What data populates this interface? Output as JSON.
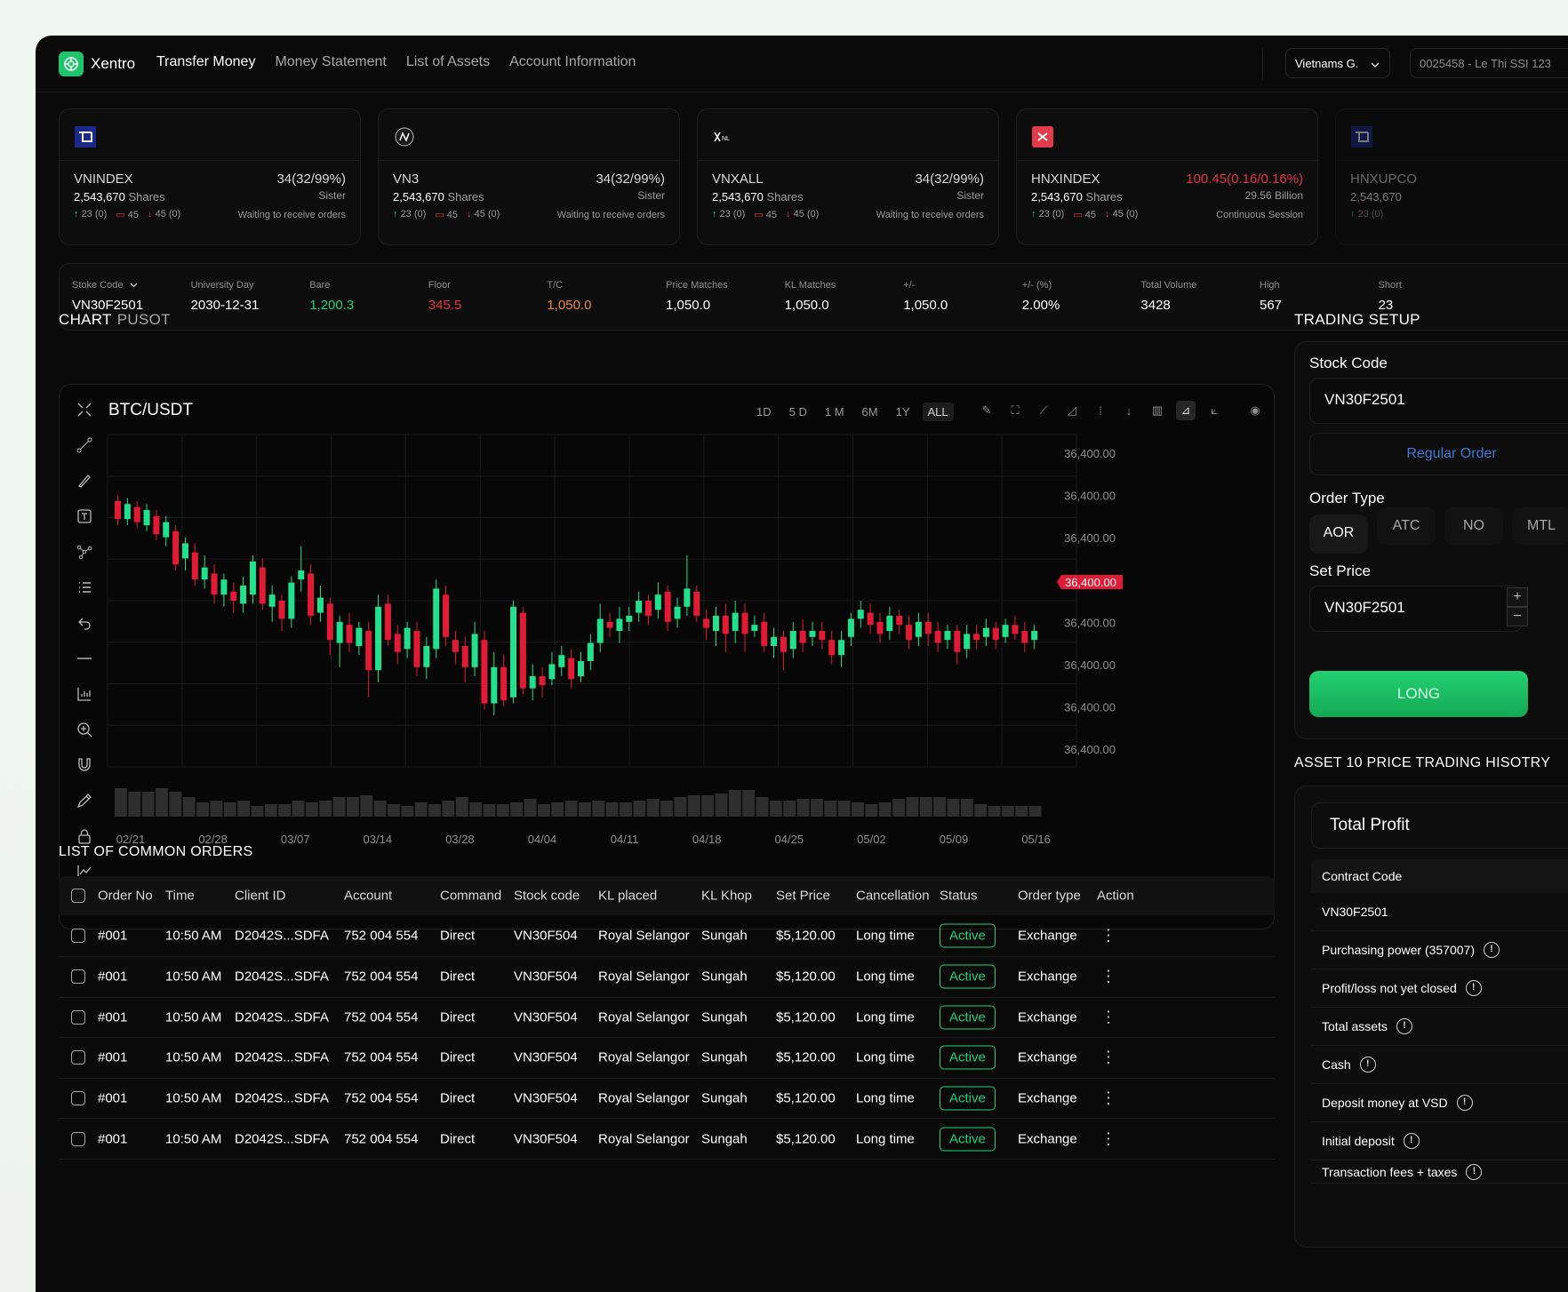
{
  "app": {
    "name": "Xentro",
    "accent": "#1fc46a"
  },
  "nav": [
    "Transfer Money",
    "Money Statement",
    "List of Assets",
    "Account Information"
  ],
  "header": {
    "region": "Vietnams G.",
    "account": "0025458 - Le Thi SSI 123"
  },
  "indices": [
    {
      "icon": "vnindex-logo-icon",
      "name": "VNINDEX",
      "value": "34(32/99%)",
      "red": false,
      "shares": "2,543,670",
      "shares_unit": "Shares",
      "sub": "Sister",
      "up": "23 (0)",
      "eq": "45",
      "down": "45 (0)",
      "status": "Waiting to receive orders"
    },
    {
      "icon": "vn3-logo-icon",
      "name": "VN3",
      "value": "34(32/99%)",
      "red": false,
      "shares": "2,543,670",
      "shares_unit": "Shares",
      "sub": "Sister",
      "up": "23 (0)",
      "eq": "45",
      "down": "45 (0)",
      "status": "Waiting to receive orders"
    },
    {
      "icon": "vnxall-logo-icon",
      "name": "VNXALL",
      "value": "34(32/99%)",
      "red": false,
      "shares": "2,543,670",
      "shares_unit": "Shares",
      "sub": "Sister",
      "up": "23 (0)",
      "eq": "45",
      "down": "45 (0)",
      "status": "Waiting to receive orders"
    },
    {
      "icon": "hnxindex-logo-icon",
      "name": "HNXINDEX",
      "value": "100.45(0.16/0.16%)",
      "red": true,
      "shares": "2,543,670",
      "shares_unit": "Shares",
      "sub": "29.56 Billion",
      "up": "23 (0)",
      "eq": "45",
      "down": "45 (0)",
      "status": "Continuous Session"
    },
    {
      "icon": "hnxupcom-logo-icon",
      "name": "HNXUPCO",
      "value": "",
      "red": false,
      "shares": "2,543,670",
      "shares_unit": "",
      "sub": "",
      "up": "23 (0)",
      "eq": "",
      "down": "",
      "status": ""
    }
  ],
  "infobar": [
    {
      "label": "Stoke Code",
      "value": "VN30F2501",
      "color": "",
      "dropdown": true
    },
    {
      "label": "University Day",
      "value": "2030-12-31",
      "color": ""
    },
    {
      "label": "Bare",
      "value": "1,200.3",
      "color": "g"
    },
    {
      "label": "Floor",
      "value": "345.5",
      "color": "r"
    },
    {
      "label": "T/C",
      "value": "1,050.0",
      "color": "o"
    },
    {
      "label": "Price Matches",
      "value": "1,050.0",
      "color": ""
    },
    {
      "label": "KL Matches",
      "value": "1,050.0",
      "color": ""
    },
    {
      "label": "+/-",
      "value": "1,050.0",
      "color": ""
    },
    {
      "label": "+/- (%)",
      "value": "2.00%",
      "color": ""
    },
    {
      "label": "Total Volume",
      "value": "3428",
      "color": ""
    },
    {
      "label": "High",
      "value": "567",
      "color": ""
    },
    {
      "label": "Short",
      "value": "23",
      "color": ""
    }
  ],
  "chart_section": {
    "title": "CHART",
    "subtitle": "PUSOT"
  },
  "chart_data": {
    "type": "candlestick",
    "pair": "BTC/USDT",
    "ranges": [
      "1D",
      "5 D",
      "1 M",
      "6M",
      "1Y",
      "ALL"
    ],
    "active_range": "ALL",
    "y_tick_labels": [
      "36,400.00",
      "36,400.00",
      "36,400.00",
      "36,400.00",
      "36,400.00",
      "36,400.00",
      "36,400.00",
      "36,400.00"
    ],
    "current_price": "36,400.00",
    "x_tick_labels": [
      "02/21",
      "02/28",
      "03/07",
      "03/14",
      "03/28",
      "04/04",
      "04/11",
      "04/18",
      "04/25",
      "05/02",
      "05/09",
      "05/16"
    ],
    "up_color": "#22e08b",
    "down_color": "#e21b35",
    "candles_approx": [
      [
        0.12,
        0.18,
        0.1,
        0.2
      ],
      [
        0.18,
        0.13,
        0.11,
        0.2
      ],
      [
        0.14,
        0.19,
        0.12,
        0.21
      ],
      [
        0.2,
        0.15,
        0.13,
        0.22
      ],
      [
        0.17,
        0.23,
        0.15,
        0.25
      ],
      [
        0.24,
        0.19,
        0.17,
        0.27
      ],
      [
        0.22,
        0.33,
        0.2,
        0.35
      ],
      [
        0.31,
        0.26,
        0.24,
        0.35
      ],
      [
        0.29,
        0.38,
        0.26,
        0.4
      ],
      [
        0.38,
        0.34,
        0.3,
        0.41
      ],
      [
        0.36,
        0.43,
        0.33,
        0.46
      ],
      [
        0.43,
        0.38,
        0.36,
        0.47
      ],
      [
        0.42,
        0.45,
        0.39,
        0.49
      ],
      [
        0.46,
        0.4,
        0.37,
        0.49
      ],
      [
        0.43,
        0.32,
        0.3,
        0.46
      ],
      [
        0.34,
        0.46,
        0.31,
        0.48
      ],
      [
        0.47,
        0.43,
        0.4,
        0.52
      ],
      [
        0.45,
        0.51,
        0.43,
        0.55
      ],
      [
        0.51,
        0.39,
        0.37,
        0.54
      ],
      [
        0.38,
        0.35,
        0.27,
        0.42
      ],
      [
        0.36,
        0.5,
        0.33,
        0.53
      ],
      [
        0.49,
        0.44,
        0.4,
        0.52
      ],
      [
        0.46,
        0.58,
        0.44,
        0.63
      ],
      [
        0.59,
        0.52,
        0.5,
        0.67
      ],
      [
        0.53,
        0.59,
        0.49,
        0.62
      ],
      [
        0.6,
        0.54,
        0.52,
        0.63
      ],
      [
        0.55,
        0.68,
        0.52,
        0.77
      ],
      [
        0.68,
        0.47,
        0.43,
        0.72
      ],
      [
        0.46,
        0.58,
        0.43,
        0.6
      ],
      [
        0.56,
        0.62,
        0.53,
        0.66
      ],
      [
        0.61,
        0.54,
        0.52,
        0.64
      ],
      [
        0.55,
        0.67,
        0.52,
        0.7
      ],
      [
        0.67,
        0.6,
        0.57,
        0.71
      ],
      [
        0.61,
        0.41,
        0.38,
        0.64
      ],
      [
        0.43,
        0.57,
        0.4,
        0.6
      ],
      [
        0.58,
        0.62,
        0.55,
        0.66
      ],
      [
        0.6,
        0.67,
        0.57,
        0.72
      ],
      [
        0.67,
        0.56,
        0.52,
        0.7
      ],
      [
        0.58,
        0.79,
        0.55,
        0.81
      ],
      [
        0.79,
        0.67,
        0.62,
        0.83
      ],
      [
        0.67,
        0.78,
        0.63,
        0.8
      ],
      [
        0.77,
        0.47,
        0.45,
        0.79
      ],
      [
        0.49,
        0.74,
        0.47,
        0.76
      ],
      [
        0.74,
        0.7,
        0.66,
        0.78
      ],
      [
        0.7,
        0.73,
        0.67,
        0.77
      ],
      [
        0.71,
        0.66,
        0.62,
        0.73
      ],
      [
        0.67,
        0.63,
        0.6,
        0.7
      ],
      [
        0.64,
        0.71,
        0.61,
        0.74
      ],
      [
        0.7,
        0.65,
        0.62,
        0.72
      ],
      [
        0.65,
        0.59,
        0.56,
        0.68
      ],
      [
        0.59,
        0.51,
        0.46,
        0.62
      ],
      [
        0.52,
        0.54,
        0.49,
        0.57
      ],
      [
        0.55,
        0.51,
        0.47,
        0.59
      ],
      [
        0.52,
        0.5,
        0.47,
        0.55
      ],
      [
        0.49,
        0.45,
        0.42,
        0.52
      ],
      [
        0.45,
        0.5,
        0.43,
        0.53
      ],
      [
        0.48,
        0.43,
        0.39,
        0.51
      ],
      [
        0.42,
        0.52,
        0.4,
        0.55
      ],
      [
        0.51,
        0.47,
        0.44,
        0.54
      ],
      [
        0.47,
        0.41,
        0.3,
        0.5
      ],
      [
        0.42,
        0.5,
        0.4,
        0.52
      ],
      [
        0.51,
        0.54,
        0.48,
        0.58
      ],
      [
        0.55,
        0.5,
        0.47,
        0.6
      ],
      [
        0.5,
        0.56,
        0.46,
        0.62
      ],
      [
        0.55,
        0.49,
        0.45,
        0.59
      ],
      [
        0.49,
        0.56,
        0.46,
        0.62
      ],
      [
        0.55,
        0.53,
        0.5,
        0.57
      ],
      [
        0.52,
        0.6,
        0.49,
        0.62
      ],
      [
        0.6,
        0.57,
        0.54,
        0.64
      ],
      [
        0.57,
        0.62,
        0.55,
        0.68
      ],
      [
        0.61,
        0.55,
        0.52,
        0.64
      ],
      [
        0.55,
        0.59,
        0.51,
        0.62
      ],
      [
        0.57,
        0.55,
        0.52,
        0.6
      ],
      [
        0.55,
        0.58,
        0.52,
        0.61
      ],
      [
        0.58,
        0.63,
        0.55,
        0.66
      ],
      [
        0.63,
        0.58,
        0.55,
        0.67
      ],
      [
        0.57,
        0.51,
        0.49,
        0.6
      ],
      [
        0.51,
        0.48,
        0.45,
        0.54
      ],
      [
        0.49,
        0.53,
        0.46,
        0.56
      ],
      [
        0.52,
        0.56,
        0.49,
        0.59
      ],
      [
        0.55,
        0.5,
        0.47,
        0.58
      ],
      [
        0.5,
        0.53,
        0.48,
        0.56
      ],
      [
        0.53,
        0.58,
        0.5,
        0.61
      ],
      [
        0.57,
        0.52,
        0.49,
        0.6
      ],
      [
        0.52,
        0.56,
        0.49,
        0.6
      ],
      [
        0.55,
        0.59,
        0.52,
        0.62
      ],
      [
        0.58,
        0.55,
        0.53,
        0.61
      ],
      [
        0.55,
        0.62,
        0.53,
        0.66
      ],
      [
        0.61,
        0.56,
        0.53,
        0.64
      ],
      [
        0.56,
        0.58,
        0.53,
        0.61
      ],
      [
        0.57,
        0.54,
        0.51,
        0.6
      ],
      [
        0.54,
        0.58,
        0.52,
        0.61
      ],
      [
        0.57,
        0.53,
        0.51,
        0.59
      ],
      [
        0.53,
        0.56,
        0.5,
        0.58
      ],
      [
        0.55,
        0.59,
        0.52,
        0.62
      ],
      [
        0.58,
        0.55,
        0.53,
        0.61
      ]
    ],
    "volume_approx": [
      0.8,
      0.7,
      0.7,
      0.8,
      0.7,
      0.55,
      0.4,
      0.45,
      0.4,
      0.45,
      0.3,
      0.35,
      0.35,
      0.45,
      0.4,
      0.45,
      0.55,
      0.55,
      0.6,
      0.45,
      0.35,
      0.3,
      0.4,
      0.35,
      0.45,
      0.55,
      0.4,
      0.35,
      0.35,
      0.4,
      0.5,
      0.35,
      0.4,
      0.45,
      0.4,
      0.45,
      0.4,
      0.4,
      0.45,
      0.5,
      0.45,
      0.55,
      0.6,
      0.6,
      0.65,
      0.75,
      0.75,
      0.55,
      0.45,
      0.45,
      0.5,
      0.5,
      0.45,
      0.45,
      0.4,
      0.35,
      0.4,
      0.5,
      0.55,
      0.55,
      0.55,
      0.5,
      0.5,
      0.35,
      0.3,
      0.3,
      0.3,
      0.3
    ]
  },
  "trading_setup": {
    "title": "TRADING SETUP",
    "stock_code_label": "Stock Code",
    "stock_code_value": "VN30F2501",
    "regular_order": "Regular Order",
    "order_type_label": "Order Type",
    "order_types": [
      "AOR",
      "ATC",
      "NO",
      "MTL"
    ],
    "active_order_type": "AOR",
    "set_price_label": "Set Price",
    "set_price_value": "VN30F2501",
    "plus": "+",
    "minus": "−",
    "long_label": "LONG"
  },
  "orders": {
    "title": "LIST OF COMMON ORDERS",
    "columns": [
      "Order No",
      "Time",
      "Client ID",
      "Account",
      "Command",
      "Stock code",
      "KL placed",
      "KL Khop",
      "Set Price",
      "Cancellation",
      "Status",
      "Order type",
      "Action"
    ],
    "rows": [
      [
        "#001",
        "10:50 AM",
        "D2042S...SDFA",
        "752 004 554",
        "Direct",
        "VN30F504",
        "Royal Selangor",
        "Sungah",
        "$5,120.00",
        "Long time",
        "Active",
        "Exchange"
      ],
      [
        "#001",
        "10:50 AM",
        "D2042S...SDFA",
        "752 004 554",
        "Direct",
        "VN30F504",
        "Royal Selangor",
        "Sungah",
        "$5,120.00",
        "Long time",
        "Active",
        "Exchange"
      ],
      [
        "#001",
        "10:50 AM",
        "D2042S...SDFA",
        "752 004 554",
        "Direct",
        "VN30F504",
        "Royal Selangor",
        "Sungah",
        "$5,120.00",
        "Long time",
        "Active",
        "Exchange"
      ],
      [
        "#001",
        "10:50 AM",
        "D2042S...SDFA",
        "752 004 554",
        "Direct",
        "VN30F504",
        "Royal Selangor",
        "Sungah",
        "$5,120.00",
        "Long time",
        "Active",
        "Exchange"
      ],
      [
        "#001",
        "10:50 AM",
        "D2042S...SDFA",
        "752 004 554",
        "Direct",
        "VN30F504",
        "Royal Selangor",
        "Sungah",
        "$5,120.00",
        "Long time",
        "Active",
        "Exchange"
      ],
      [
        "#001",
        "10:50 AM",
        "D2042S...SDFA",
        "752 004 554",
        "Direct",
        "VN30F504",
        "Royal Selangor",
        "Sungah",
        "$5,120.00",
        "Long time",
        "Active",
        "Exchange"
      ]
    ]
  },
  "history": {
    "title": "ASSET 10 PRICE TRADING HISOTRY",
    "box_title": "Total Profit",
    "head": "Contract Code",
    "rows": [
      {
        "label": "VN30F2501",
        "info": false
      },
      {
        "label": "Purchasing power (357007)",
        "info": true
      },
      {
        "label": "Profit/loss not yet closed",
        "info": true
      },
      {
        "label": "Total assets",
        "info": true
      },
      {
        "label": "Cash",
        "info": true
      },
      {
        "label": "Deposit money at VSD",
        "info": true
      },
      {
        "label": "Initial deposit",
        "info": true
      },
      {
        "label": "Transaction fees + taxes",
        "info": true
      }
    ]
  }
}
